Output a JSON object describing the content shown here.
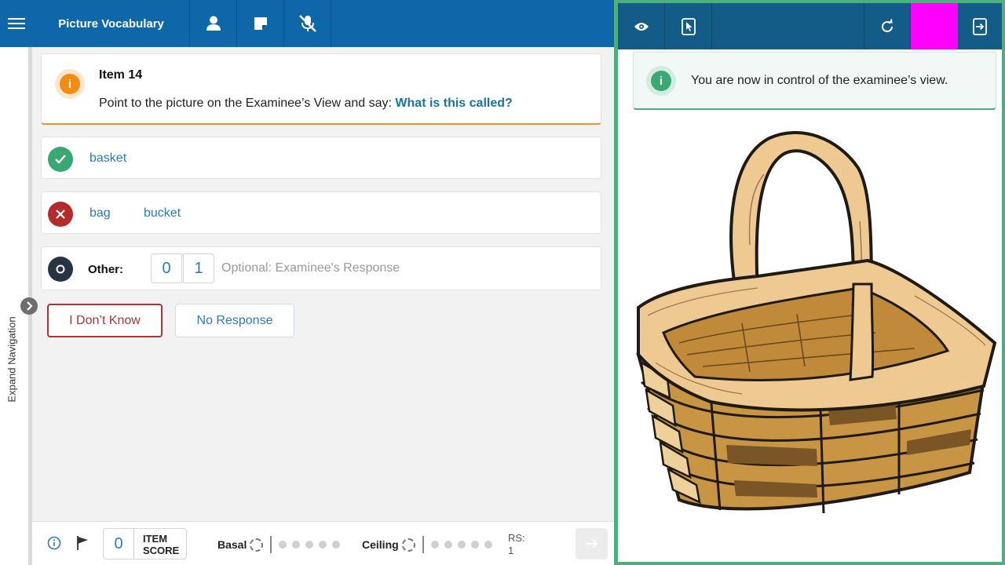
{
  "header": {
    "title": "Picture Vocabulary",
    "icons": [
      "menu-icon",
      "user-icon",
      "note-icon",
      "mic-off-icon"
    ]
  },
  "sidebar": {
    "label": "Expand Navigation"
  },
  "item": {
    "title": "Item 14",
    "prompt": "Point to the picture on the Examinee’s View and say: ",
    "question": "What is this called?"
  },
  "responses": {
    "correct": [
      "basket"
    ],
    "incorrect": [
      "bag",
      "bucket"
    ],
    "other": {
      "label": "Other:",
      "score_options": [
        "0",
        "1"
      ],
      "placeholder": "Optional: Examinee's Response"
    }
  },
  "buttons": {
    "dont_know": "I Don’t Know",
    "no_response": "No Response"
  },
  "footer": {
    "item_score_value": "0",
    "item_score_label_1": "ITEM",
    "item_score_label_2": "SCORE",
    "basal_label": "Basal",
    "ceiling_label": "Ceiling",
    "rs_label": "RS:",
    "rs_value": "1"
  },
  "examinee_view": {
    "notice": "You are now in control of the examinee’s view.",
    "picture": "basket",
    "toolbar_icons": [
      "eye-icon",
      "tablet-pointer-icon",
      "refresh-icon",
      "exit-icon"
    ],
    "highlight_color": "#ff00ff"
  },
  "colors": {
    "header_blue": "#0e67a8",
    "right_header_blue": "#135c87",
    "correct_green": "#3aa873",
    "incorrect_red": "#b52b2b",
    "warning_orange": "#f38c12",
    "link_blue": "#2c7ab8",
    "panel_border_green": "#4caf7d"
  }
}
